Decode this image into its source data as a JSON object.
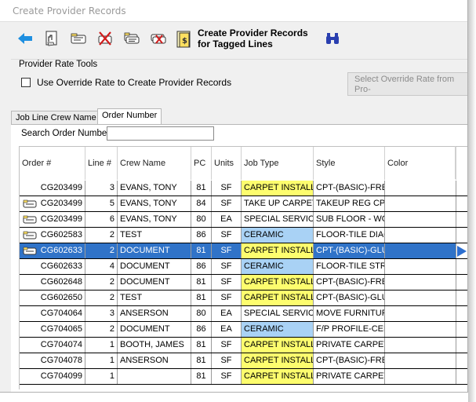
{
  "window": {
    "title": "Create Provider Records"
  },
  "toolbar": {
    "buttons": [
      {
        "name": "back-arrow-icon"
      },
      {
        "name": "document-hand-icon"
      },
      {
        "name": "note-card-icon"
      },
      {
        "name": "note-delete-icon"
      },
      {
        "name": "note-stack-icon"
      },
      {
        "name": "note-cancel-icon"
      },
      {
        "name": "create-records-icon"
      }
    ],
    "create_label": "Create Provider Records\nfor Tagged Lines",
    "search_icon": "binoculars-icon"
  },
  "rate_tools": {
    "title": "Provider Rate Tools",
    "override_label": "Use Override Rate to Create Provider Records",
    "override_checked": false,
    "select_button_label": "Select Override Rate from Pro-\nRate Matrix for Highlighted I"
  },
  "tabs": [
    {
      "label": "Job Line Crew Name",
      "active": false
    },
    {
      "label": "Order Number",
      "active": true
    }
  ],
  "search": {
    "label": "Search Order Number",
    "value": ""
  },
  "grid": {
    "columns": [
      "Order #",
      "Line #",
      "Crew Name",
      "PC",
      "Units",
      "Job Type",
      "Style",
      "Color"
    ],
    "rows": [
      {
        "order": "CG203499",
        "line": "3",
        "crew": "EVANS, TONY",
        "pc": "81",
        "units": "SF",
        "job": "CARPET INSTALL",
        "style": "CPT-(BASIC)-FREI",
        "color": "",
        "note": false,
        "selected": false,
        "jobColor": "carpet"
      },
      {
        "order": "CG203499",
        "line": "5",
        "crew": "EVANS, TONY",
        "pc": "84",
        "units": "SF",
        "job": "TAKE UP CARPET",
        "style": "TAKEUP REG CPT.",
        "color": "",
        "note": true,
        "selected": false,
        "jobColor": ""
      },
      {
        "order": "CG203499",
        "line": "6",
        "crew": "EVANS, TONY",
        "pc": "80",
        "units": "EA",
        "job": "SPECIAL SERVICE",
        "style": "SUB FLOOR - WO",
        "color": "",
        "note": true,
        "selected": false,
        "jobColor": ""
      },
      {
        "order": "CG602583",
        "line": "2",
        "crew": "TEST",
        "pc": "86",
        "units": "SF",
        "job": "CERAMIC",
        "style": "FLOOR-TILE DIAG",
        "color": "",
        "note": true,
        "selected": false,
        "jobColor": "ceramic"
      },
      {
        "order": "CG602633",
        "line": "2",
        "crew": "DOCUMENT",
        "pc": "81",
        "units": "SF",
        "job": "CARPET INSTALL",
        "style": "CPT-(BASIC)-GLU",
        "color": "",
        "note": true,
        "selected": true,
        "jobColor": "carpet"
      },
      {
        "order": "CG602633",
        "line": "4",
        "crew": "DOCUMENT",
        "pc": "86",
        "units": "SF",
        "job": "CERAMIC",
        "style": "FLOOR-TILE STRA",
        "color": "",
        "note": false,
        "selected": false,
        "jobColor": "ceramic"
      },
      {
        "order": "CG602648",
        "line": "2",
        "crew": "DOCUMENT",
        "pc": "81",
        "units": "SF",
        "job": "CARPET INSTALL",
        "style": "CPT-(BASIC)-FREI",
        "color": "",
        "note": false,
        "selected": false,
        "jobColor": "carpet"
      },
      {
        "order": "CG602650",
        "line": "2",
        "crew": "TEST",
        "pc": "81",
        "units": "SF",
        "job": "CARPET INSTALL",
        "style": "CPT-(BASIC)-GLU",
        "color": "",
        "note": false,
        "selected": false,
        "jobColor": "carpet"
      },
      {
        "order": "CG704064",
        "line": "3",
        "crew": "ANSERSON",
        "pc": "80",
        "units": "EA",
        "job": "SPECIAL SERVICE",
        "style": "MOVE FURNITURE",
        "color": "",
        "note": false,
        "selected": false,
        "jobColor": ""
      },
      {
        "order": "CG704065",
        "line": "2",
        "crew": "DOCUMENT",
        "pc": "86",
        "units": "EA",
        "job": "CERAMIC",
        "style": "F/P PROFILE-CER/",
        "color": "",
        "note": false,
        "selected": false,
        "jobColor": "ceramic"
      },
      {
        "order": "CG704074",
        "line": "1",
        "crew": "BOOTH, JAMES",
        "pc": "81",
        "units": "SF",
        "job": "CARPET INSTALL",
        "style": "PRIVATE CARPET",
        "color": "",
        "note": false,
        "selected": false,
        "jobColor": "carpet"
      },
      {
        "order": "CG704078",
        "line": "1",
        "crew": "ANSERSON",
        "pc": "81",
        "units": "SF",
        "job": "CARPET INSTALL",
        "style": "CPT-(BASIC)-FREI",
        "color": "",
        "note": false,
        "selected": false,
        "jobColor": "carpet"
      },
      {
        "order": "CG704099",
        "line": "1",
        "crew": "",
        "pc": "81",
        "units": "SF",
        "job": "CARPET INSTALL",
        "style": "PRIVATE CARPET",
        "color": "",
        "note": false,
        "selected": false,
        "jobColor": "carpet"
      }
    ]
  },
  "colors": {
    "selection": "#3073c8",
    "carpet": "#fdfd6e",
    "ceramic": "#a9d2f5",
    "accent": "#1a6fd0"
  }
}
